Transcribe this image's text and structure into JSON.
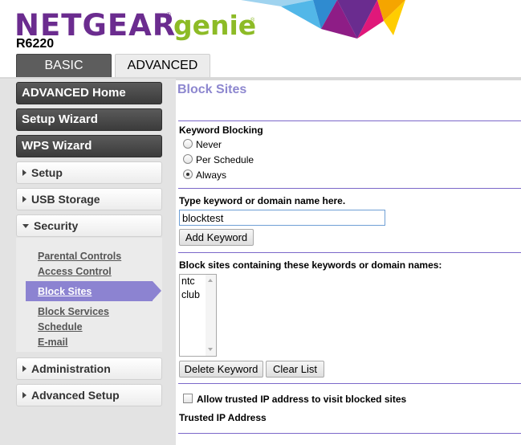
{
  "brand": {
    "logo_text": "NETGEAR",
    "logo_reg": "®",
    "product": "genie",
    "product_reg": "®",
    "model": "R6220",
    "colors": {
      "purple": "#6b2c8f",
      "green": "#8dbb26",
      "accent": "#8d87cf"
    }
  },
  "tabs": [
    {
      "label": "BASIC",
      "active": false
    },
    {
      "label": "ADVANCED",
      "active": true
    }
  ],
  "sidebar": {
    "advanced_home": "ADVANCED Home",
    "setup_wizard": "Setup Wizard",
    "wps_wizard": "WPS Wizard",
    "setup": "Setup",
    "usb_storage": "USB Storage",
    "security": "Security",
    "security_items": [
      "Parental Controls",
      "Access Control",
      "Block Sites",
      "Block Services",
      "Schedule",
      "E-mail"
    ],
    "active_item": "Block Sites",
    "administration": "Administration",
    "advanced_setup": "Advanced Setup"
  },
  "main": {
    "title": "Block Sites",
    "keyword_blocking_label": "Keyword Blocking",
    "radio_options": [
      "Never",
      "Per Schedule",
      "Always"
    ],
    "selected_option": "Always",
    "keyword_prompt": "Type keyword or domain name here.",
    "keyword_value": "blocktest",
    "add_keyword_button": "Add Keyword",
    "list_label": "Block sites containing these keywords or domain names:",
    "keywords": [
      "ntc",
      "club"
    ],
    "delete_keyword_button": "Delete Keyword",
    "clear_list_button": "Clear List",
    "allow_trusted_label": "Allow trusted IP address to visit blocked sites",
    "allow_trusted_checked": false,
    "trusted_ip_label": "Trusted IP Address"
  }
}
